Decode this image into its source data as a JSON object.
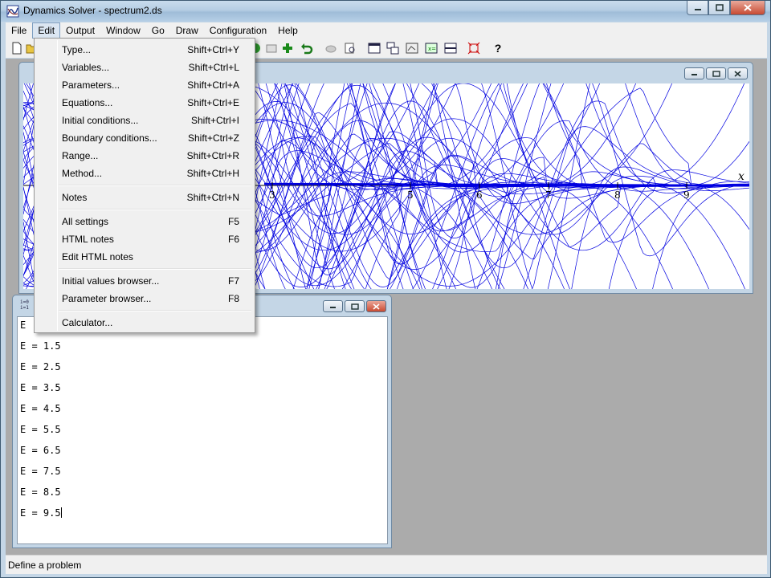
{
  "window": {
    "title": "Dynamics Solver - spectrum2.ds",
    "icon": "dynamics-solver-icon"
  },
  "menubar": {
    "items": [
      "File",
      "Edit",
      "Output",
      "Window",
      "Go",
      "Draw",
      "Configuration",
      "Help"
    ],
    "active": "Edit"
  },
  "edit_menu": {
    "groups": [
      [
        {
          "label": "Type...",
          "shortcut": "Shift+Ctrl+Y"
        },
        {
          "label": "Variables...",
          "shortcut": "Shift+Ctrl+L"
        },
        {
          "label": "Parameters...",
          "shortcut": "Shift+Ctrl+A"
        },
        {
          "label": "Equations...",
          "shortcut": "Shift+Ctrl+E"
        },
        {
          "label": "Initial conditions...",
          "shortcut": "Shift+Ctrl+I"
        },
        {
          "label": "Boundary conditions...",
          "shortcut": "Shift+Ctrl+Z"
        },
        {
          "label": "Range...",
          "shortcut": "Shift+Ctrl+R"
        },
        {
          "label": "Method...",
          "shortcut": "Shift+Ctrl+H"
        }
      ],
      [
        {
          "label": "Notes",
          "shortcut": "Shift+Ctrl+N"
        }
      ],
      [
        {
          "label": "All settings",
          "shortcut": "F5"
        },
        {
          "label": "HTML notes",
          "shortcut": "F6"
        },
        {
          "label": "Edit HTML notes",
          "shortcut": ""
        }
      ],
      [
        {
          "label": "Initial values browser...",
          "shortcut": "F7"
        },
        {
          "label": "Parameter browser...",
          "shortcut": "F8"
        }
      ],
      [
        {
          "label": "Calculator...",
          "shortcut": ""
        }
      ]
    ]
  },
  "toolbar": {
    "tools": [
      "new-file-icon",
      "open-folder-icon",
      "run-icon",
      "add-icon",
      "undo-icon",
      "erase-icon",
      "print-preview-icon",
      "window-icon",
      "tile-icon",
      "graph-icon",
      "table-icon",
      "split-icon",
      "fit-icon",
      "help-icon"
    ],
    "help_label": "?"
  },
  "plot": {
    "axis_label": "x",
    "ticks": [
      "3",
      "5",
      "6",
      "7",
      "8",
      "9"
    ],
    "curve_color": "#0000e0"
  },
  "text_window": {
    "lines": [
      "E",
      "E = 1.5",
      "E = 2.5",
      "E = 3.5",
      "E = 4.5",
      "E = 5.5",
      "E = 6.5",
      "E = 7.5",
      "E = 8.5",
      "E = 9.5"
    ]
  },
  "status": {
    "text": "Define a problem"
  },
  "colors": {
    "title_bar": "#b5cde3",
    "menu_bg": "#f0f0f0",
    "mdi_bg": "#ababab",
    "plot_blue": "#0000e0"
  }
}
